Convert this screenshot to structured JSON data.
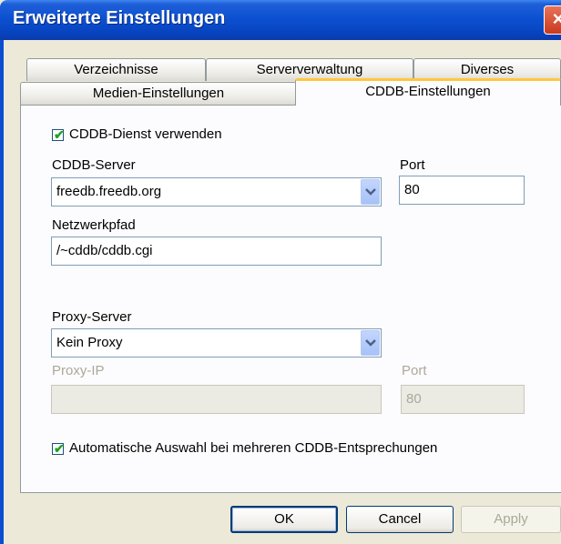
{
  "window": {
    "title": "Erweiterte Einstellungen",
    "close_symbol": "×"
  },
  "tabs": {
    "row_back": [
      "Verzeichnisse",
      "Serververwaltung",
      "Diverses"
    ],
    "row_front": [
      "Medien-Einstellungen",
      "CDDB-Einstellungen"
    ],
    "selected": "CDDB-Einstellungen"
  },
  "cddb": {
    "use_service_label": "CDDB-Dienst verwenden",
    "use_service_checked": true,
    "server_label": "CDDB-Server",
    "server_value": "freedb.freedb.org",
    "port_label": "Port",
    "port_value": "80",
    "netpath_label": "Netzwerkpfad",
    "netpath_value": "/~cddb/cddb.cgi"
  },
  "proxy": {
    "server_label": "Proxy-Server",
    "server_value": "Kein Proxy",
    "ip_label": "Proxy-IP",
    "ip_value": "",
    "port_label": "Port",
    "port_value": "80"
  },
  "auto_select": {
    "label": "Automatische Auswahl bei mehreren CDDB-Entsprechungen",
    "checked": true
  },
  "buttons": {
    "ok": "OK",
    "cancel": "Cancel",
    "apply": "Apply"
  },
  "colors": {
    "title_bar": "#0a4fd0",
    "dialog_bg": "#ece9d8",
    "selected_tab_accent": "#ffc73c",
    "checkmark": "#21a121"
  }
}
